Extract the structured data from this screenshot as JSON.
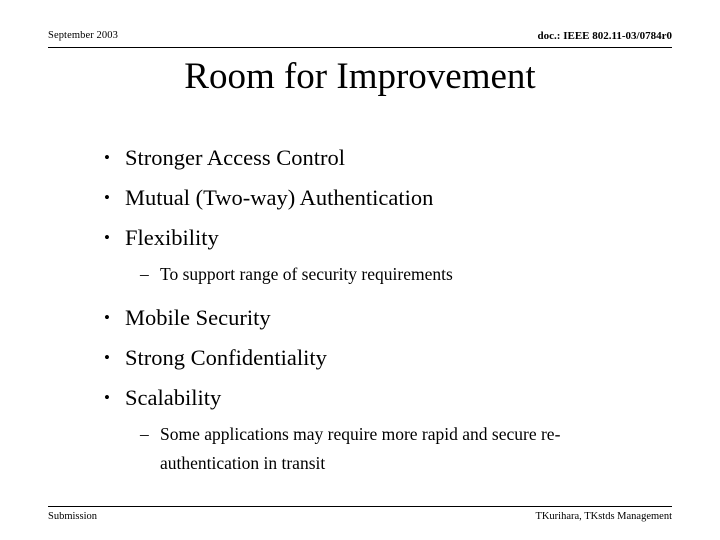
{
  "slide": {
    "header": {
      "date": "September 2003",
      "doc_id": "doc.: IEEE 802.11-03/0784r0"
    },
    "title": "Room for Improvement",
    "content": {
      "bullet_marker": "•",
      "sub_marker": "–",
      "group_one": [
        "Stronger Access Control",
        "Mutual (Two-way) Authentication",
        "Flexibility"
      ],
      "sub_one": "To support range of security requirements",
      "group_two": [
        "Mobile Security",
        "Strong Confidentiality",
        "Scalability"
      ],
      "sub_two": "Some applications may require more rapid and secure re-authentication in transit"
    },
    "footer": {
      "left": "Submission",
      "right": "TKurihara, TKstds Management"
    },
    "colors": {
      "background": "#ffffff",
      "text": "#000000",
      "rule": "#000000"
    }
  }
}
